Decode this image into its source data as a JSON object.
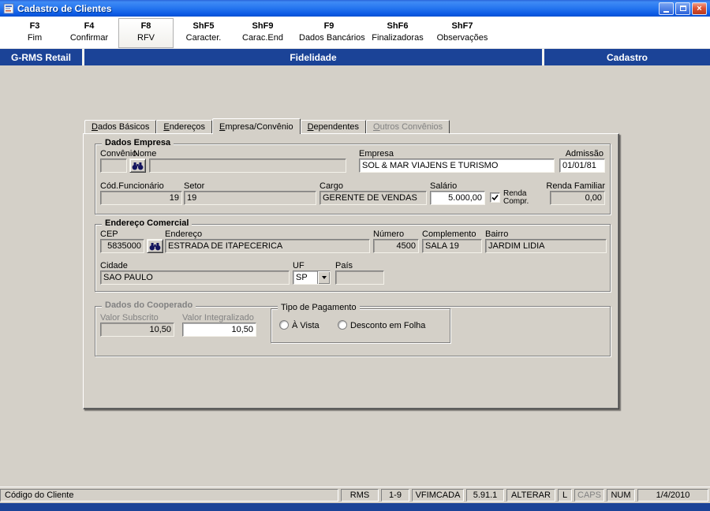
{
  "window": {
    "title": "Cadastro de Clientes"
  },
  "colors": {
    "title_bar": "#0c5ae4",
    "header_bar": "#1b4397",
    "panel_gray": "#d4d0c8",
    "bottom_strip": "#1b4397"
  },
  "toolbar": {
    "buttons": [
      {
        "key": "F3",
        "label": "Fim"
      },
      {
        "key": "F4",
        "label": "Confirmar"
      },
      {
        "key": "F8",
        "label": "RFV"
      },
      {
        "key": "ShF5",
        "label": "Caracter."
      },
      {
        "key": "ShF9",
        "label": "Carac.End"
      },
      {
        "key": "F9",
        "label": "Dados Bancários"
      },
      {
        "key": "ShF6",
        "label": "Finalizadoras"
      },
      {
        "key": "ShF7",
        "label": "Observações"
      }
    ]
  },
  "header": {
    "left": "G-RMS Retail",
    "center": "Fidelidade",
    "right": "Cadastro"
  },
  "tabs": {
    "items": [
      {
        "label": "Dados Básicos"
      },
      {
        "label": "Endereços"
      },
      {
        "label": "Empresa/Convênio",
        "active": true
      },
      {
        "label": "Dependentes"
      },
      {
        "label": "Outros Convênios",
        "disabled": true
      }
    ]
  },
  "form": {
    "empresa": {
      "title": "Dados Empresa",
      "convenio": {
        "label": "Convênio",
        "value": ""
      },
      "nome": {
        "label": "Nome",
        "value": ""
      },
      "empresa": {
        "label": "Empresa",
        "value": "SOL & MAR VIAJENS E TURISMO"
      },
      "admissao": {
        "label": "Admissão",
        "value": "01/01/81"
      },
      "cod_funcionario": {
        "label": "Cód.Funcionário",
        "value": "19"
      },
      "setor": {
        "label": "Setor",
        "value": "19"
      },
      "cargo": {
        "label": "Cargo",
        "value": "GERENTE DE VENDAS"
      },
      "salario": {
        "label": "Salário",
        "value": "5.000,00"
      },
      "renda_compr": {
        "line1": "Renda",
        "line2": "Compr.",
        "checked": true
      },
      "renda_familiar": {
        "label": "Renda Familiar",
        "value": "0,00"
      }
    },
    "endereco": {
      "title": "Endereço Comercial",
      "cep": {
        "label": "CEP",
        "value": "5835000"
      },
      "endereco": {
        "label": "Endereço",
        "value": "ESTRADA DE ITAPECERICA"
      },
      "numero": {
        "label": "Número",
        "value": "4500"
      },
      "complemento": {
        "label": "Complemento",
        "value": "SALA 19"
      },
      "bairro": {
        "label": "Bairro",
        "value": "JARDIM LIDIA"
      },
      "cidade": {
        "label": "Cidade",
        "value": "SAO PAULO"
      },
      "uf": {
        "label": "UF",
        "value": "SP"
      },
      "pais": {
        "label": "País",
        "value": ""
      }
    },
    "cooperado": {
      "title": "Dados do Cooperado",
      "valor_subscrito": {
        "label": "Valor Subscrito",
        "value": "10,50"
      },
      "valor_integralizado": {
        "label": "Valor Integralizado",
        "value": "10,50"
      },
      "tipo_pagamento": {
        "title": "Tipo de Pagamento",
        "avista": "À Vista",
        "desconto": "Desconto em Folha"
      }
    }
  },
  "statusbar": {
    "left": "Código do Cliente",
    "rms": "RMS",
    "range": "1-9",
    "program": "VFIMCADA",
    "version": "5.91.1",
    "mode": "ALTERAR",
    "l": "L",
    "caps": "CAPS",
    "num": "NUM",
    "date": "1/4/2010"
  }
}
